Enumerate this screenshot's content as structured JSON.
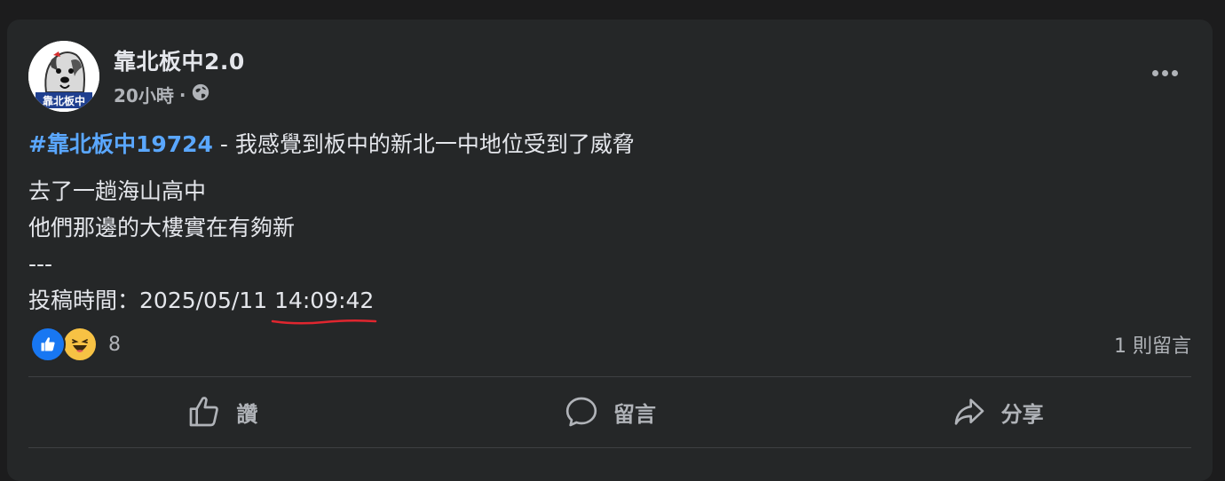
{
  "post": {
    "author": "靠北板中2.0",
    "time": "20小時",
    "separator": "·",
    "audience_icon": "globe-icon",
    "avatar_text": "靠北板中",
    "hashtag": "#靠北板中19724",
    "headline": " - 我感覺到板中的新北一中地位受到了威脅",
    "body_lines": [
      "去了一趟海山高中",
      "他們那邊的大樓實在有夠新",
      "---"
    ],
    "timestamp_label": "投稿時間：",
    "timestamp_date": "2025/05/11 ",
    "timestamp_time": "14:09:42"
  },
  "reactions": {
    "icons": [
      "like-icon",
      "haha-icon"
    ],
    "count": "8",
    "comments": "1 則留言"
  },
  "actions": {
    "like": "讚",
    "comment": "留言",
    "share": "分享"
  },
  "colors": {
    "background": "#1c1c1d",
    "card": "#252728",
    "hashtag": "#5aa7ff",
    "like_blue": "#1877f2",
    "annotation_red": "#e0262f"
  }
}
